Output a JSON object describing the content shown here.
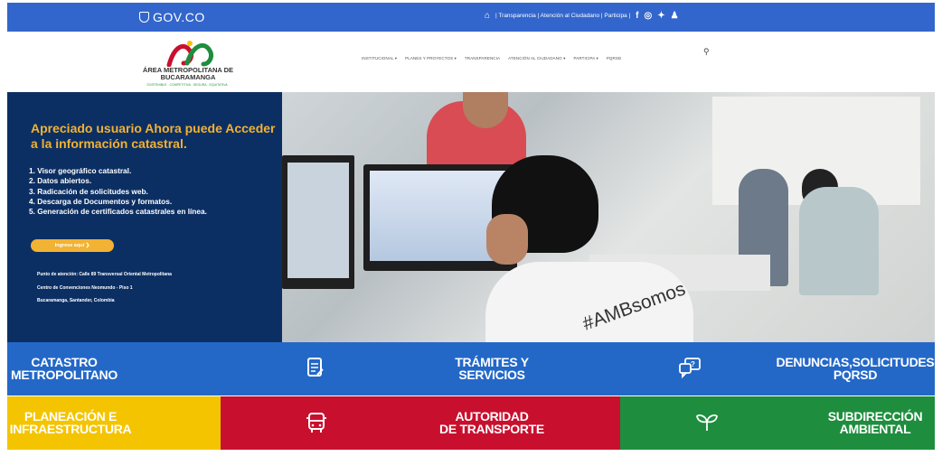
{
  "govbar": {
    "logo_text": "GOV.CO",
    "links": "| Transparencia | Atención al Ciudadano | Participa |",
    "home_icon": "home-icon",
    "social": [
      "f",
      "◎",
      "✦",
      "♟"
    ]
  },
  "header": {
    "logo_name": "ÁREA METROPOLITANA DE BUCARAMANGA",
    "logo_tagline": "SOSTENIBLE · COMPETITIVA · SEGURA · EQUITATIVA",
    "nav": [
      "INSTITUCIONAL ▾",
      "PLANES Y PROYECTOS ▾",
      "TRANSPARENCIA",
      "ATENCIÓN AL CIUDADANO ▾",
      "PARTICIPA ▾",
      "PQRSD"
    ],
    "search_icon": "search-icon"
  },
  "hero": {
    "title": "Apreciado usuario Ahora puede Acceder a la información catastral.",
    "list": [
      "1. Visor geográfico catastral.",
      "2. Datos abiertos.",
      "3. Radicación de solicitudes web.",
      "4. Descarga de Documentos y formatos.",
      "5. Generación de certificados catastrales en línea."
    ],
    "button": "Ingrese aquí ❯",
    "info": [
      "Punto de atención: Calle 89 Transversal Oriental Metropolitana",
      "Centro de Convenciones Neomundo - Piso 1",
      "Bucaramanga, Santander, Colombia"
    ],
    "shirt_text": "#AMBsomos"
  },
  "tiles": {
    "catastro": "CATASTRO\nMETROPOLITANO",
    "tramites": "TRÁMITES Y\nSERVICIOS",
    "denuncias": "DENUNCIAS,SOLICITUDES\nPQRSD",
    "planeacion": "PLANEACIÓN E\nINFRAESTRUCTURA",
    "autoridad": "AUTORIDAD\nDE TRANSPORTE",
    "subdireccion": "SUBDIRECCIÓN\nAMBIENTAL"
  },
  "colors": {
    "govbar": "#3366cc",
    "hero_panel": "#0c2f63",
    "accent_yellow": "#f2b233",
    "tile_blue": "#2468c7",
    "tile_yellow": "#f5c400",
    "tile_red": "#c8102e",
    "tile_green": "#1e8e3e"
  }
}
